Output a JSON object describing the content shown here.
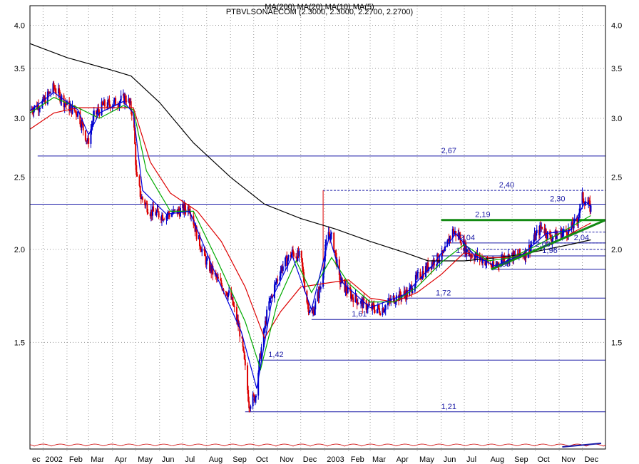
{
  "chart_data": {
    "type": "candlestick",
    "title": "PTBVLSONAECOM (2.3000, 2.3000, 2.2700, 2.2700)",
    "title_overlay": "MA(200) MA(20) MA(10) MA(5)",
    "yaxis": {
      "scale": "log",
      "range": [
        1.1,
        4.25
      ],
      "ticks": [
        1.5,
        2.0,
        2.5,
        3.0,
        3.5,
        4.0
      ],
      "tick_labels": [
        "1.5",
        "2.0",
        "2.5",
        "3.0",
        "3.5",
        "4.0"
      ]
    },
    "xaxis": {
      "range": [
        "2001-12-15",
        "2003-12-31"
      ],
      "tick_labels": [
        {
          "date": "2001-12-15",
          "label": "ec"
        },
        {
          "date": "2002-01-01",
          "label": "2002"
        },
        {
          "date": "2002-02-01",
          "label": "Feb"
        },
        {
          "date": "2002-03-01",
          "label": "Mar"
        },
        {
          "date": "2002-04-01",
          "label": "Apr"
        },
        {
          "date": "2002-05-01",
          "label": "May"
        },
        {
          "date": "2002-06-01",
          "label": "Jun"
        },
        {
          "date": "2002-07-01",
          "label": "Jul"
        },
        {
          "date": "2002-08-01",
          "label": "Aug"
        },
        {
          "date": "2002-09-01",
          "label": "Sep"
        },
        {
          "date": "2002-10-01",
          "label": "Oct"
        },
        {
          "date": "2002-11-01",
          "label": "Nov"
        },
        {
          "date": "2002-12-01",
          "label": "Dec"
        },
        {
          "date": "2003-01-01",
          "label": "2003"
        },
        {
          "date": "2003-02-01",
          "label": "Feb"
        },
        {
          "date": "2003-03-01",
          "label": "Mar"
        },
        {
          "date": "2003-04-01",
          "label": "Apr"
        },
        {
          "date": "2003-05-01",
          "label": "May"
        },
        {
          "date": "2003-06-01",
          "label": "Jun"
        },
        {
          "date": "2003-07-01",
          "label": "Jul"
        },
        {
          "date": "2003-08-01",
          "label": "Aug"
        },
        {
          "date": "2003-09-01",
          "label": "Sep"
        },
        {
          "date": "2003-10-01",
          "label": "Oct"
        },
        {
          "date": "2003-11-01",
          "label": "Nov"
        },
        {
          "date": "2003-12-01",
          "label": "Dec"
        }
      ]
    },
    "price_path": [
      [
        "2001-12-15",
        3.08
      ],
      [
        "2002-01-01",
        3.15
      ],
      [
        "2002-01-15",
        3.3
      ],
      [
        "2002-02-01",
        3.12
      ],
      [
        "2002-02-15",
        3.05
      ],
      [
        "2002-02-28",
        2.78
      ],
      [
        "2002-03-08",
        3.02
      ],
      [
        "2002-03-20",
        3.12
      ],
      [
        "2002-04-05",
        3.15
      ],
      [
        "2002-04-20",
        3.2
      ],
      [
        "2002-04-28",
        3.02
      ],
      [
        "2002-05-02",
        2.5
      ],
      [
        "2002-05-08",
        2.35
      ],
      [
        "2002-05-20",
        2.25
      ],
      [
        "2002-06-05",
        2.22
      ],
      [
        "2002-06-20",
        2.24
      ],
      [
        "2002-07-10",
        2.28
      ],
      [
        "2002-07-20",
        2.08
      ],
      [
        "2002-08-01",
        1.92
      ],
      [
        "2002-08-15",
        1.82
      ],
      [
        "2002-09-01",
        1.73
      ],
      [
        "2002-09-15",
        1.52
      ],
      [
        "2002-09-25",
        1.24
      ],
      [
        "2002-10-03",
        1.27
      ],
      [
        "2002-10-10",
        1.45
      ],
      [
        "2002-10-20",
        1.68
      ],
      [
        "2002-11-05",
        1.88
      ],
      [
        "2002-11-20",
        1.98
      ],
      [
        "2002-12-01",
        1.95
      ],
      [
        "2002-12-08",
        1.72
      ],
      [
        "2002-12-15",
        1.62
      ],
      [
        "2002-12-28",
        1.8
      ],
      [
        "2003-01-05",
        2.12
      ],
      [
        "2003-01-12",
        2.05
      ],
      [
        "2003-01-20",
        1.82
      ],
      [
        "2003-02-01",
        1.75
      ],
      [
        "2003-02-15",
        1.7
      ],
      [
        "2003-03-01",
        1.67
      ],
      [
        "2003-03-15",
        1.66
      ],
      [
        "2003-04-01",
        1.72
      ],
      [
        "2003-04-20",
        1.75
      ],
      [
        "2003-05-01",
        1.83
      ],
      [
        "2003-05-20",
        1.92
      ],
      [
        "2003-06-05",
        1.97
      ],
      [
        "2003-06-15",
        2.12
      ],
      [
        "2003-06-25",
        2.08
      ],
      [
        "2003-07-05",
        1.98
      ],
      [
        "2003-07-20",
        1.95
      ],
      [
        "2003-08-01",
        1.92
      ],
      [
        "2003-08-08",
        1.89
      ],
      [
        "2003-08-20",
        1.95
      ],
      [
        "2003-09-05",
        1.96
      ],
      [
        "2003-09-20",
        1.98
      ],
      [
        "2003-10-01",
        2.08
      ],
      [
        "2003-10-10",
        2.15
      ],
      [
        "2003-10-20",
        2.07
      ],
      [
        "2003-11-01",
        2.1
      ],
      [
        "2003-11-15",
        2.12
      ],
      [
        "2003-11-25",
        2.2
      ],
      [
        "2003-12-01",
        2.35
      ],
      [
        "2003-12-08",
        2.3
      ],
      [
        "2003-12-12",
        2.27
      ]
    ],
    "series": [
      {
        "name": "MA(200)",
        "color": "#000000",
        "points": [
          [
            "2001-12-15",
            3.78
          ],
          [
            "2002-02-01",
            3.62
          ],
          [
            "2002-04-01",
            3.48
          ],
          [
            "2002-04-25",
            3.42
          ],
          [
            "2002-06-01",
            3.15
          ],
          [
            "2002-07-15",
            2.78
          ],
          [
            "2002-09-01",
            2.5
          ],
          [
            "2002-10-15",
            2.3
          ],
          [
            "2002-12-01",
            2.2
          ],
          [
            "2003-01-15",
            2.13
          ],
          [
            "2003-03-01",
            2.05
          ],
          [
            "2003-04-15",
            1.98
          ],
          [
            "2003-05-15",
            1.93
          ],
          [
            "2003-07-01",
            1.93
          ],
          [
            "2003-08-15",
            1.95
          ],
          [
            "2003-09-15",
            1.97
          ],
          [
            "2003-10-15",
            2.0
          ],
          [
            "2003-11-15",
            2.03
          ],
          [
            "2003-12-12",
            2.06
          ]
        ]
      },
      {
        "name": "MA(20)",
        "color": "#dd0000",
        "points": [
          [
            "2001-12-15",
            2.9
          ],
          [
            "2002-01-15",
            3.05
          ],
          [
            "2002-02-15",
            3.1
          ],
          [
            "2002-04-01",
            3.1
          ],
          [
            "2002-04-28",
            3.1
          ],
          [
            "2002-05-20",
            2.62
          ],
          [
            "2002-06-15",
            2.38
          ],
          [
            "2002-07-20",
            2.25
          ],
          [
            "2002-08-20",
            2.05
          ],
          [
            "2002-09-20",
            1.78
          ],
          [
            "2002-10-15",
            1.52
          ],
          [
            "2002-11-05",
            1.65
          ],
          [
            "2002-12-01",
            1.78
          ],
          [
            "2003-01-01",
            1.8
          ],
          [
            "2003-02-01",
            1.82
          ],
          [
            "2003-03-01",
            1.72
          ],
          [
            "2003-04-01",
            1.7
          ],
          [
            "2003-05-01",
            1.75
          ],
          [
            "2003-06-01",
            1.85
          ],
          [
            "2003-07-01",
            1.98
          ],
          [
            "2003-08-01",
            1.95
          ],
          [
            "2003-09-01",
            1.95
          ],
          [
            "2003-10-01",
            1.99
          ],
          [
            "2003-11-01",
            2.06
          ],
          [
            "2003-12-12",
            2.17
          ]
        ]
      },
      {
        "name": "MA(10)",
        "color": "#00aa00",
        "points": [
          [
            "2001-12-15",
            3.05
          ],
          [
            "2002-01-15",
            3.2
          ],
          [
            "2002-02-15",
            3.1
          ],
          [
            "2002-03-15",
            3.0
          ],
          [
            "2002-04-15",
            3.12
          ],
          [
            "2002-04-28",
            3.08
          ],
          [
            "2002-05-15",
            2.55
          ],
          [
            "2002-06-15",
            2.25
          ],
          [
            "2002-07-15",
            2.25
          ],
          [
            "2002-08-15",
            1.93
          ],
          [
            "2002-09-20",
            1.6
          ],
          [
            "2002-10-10",
            1.38
          ],
          [
            "2002-11-01",
            1.7
          ],
          [
            "2002-11-25",
            1.93
          ],
          [
            "2002-12-15",
            1.75
          ],
          [
            "2003-01-10",
            1.95
          ],
          [
            "2003-02-01",
            1.8
          ],
          [
            "2003-03-01",
            1.7
          ],
          [
            "2003-04-01",
            1.7
          ],
          [
            "2003-05-01",
            1.78
          ],
          [
            "2003-06-01",
            1.92
          ],
          [
            "2003-07-01",
            2.03
          ],
          [
            "2003-08-01",
            1.93
          ],
          [
            "2003-09-01",
            1.95
          ],
          [
            "2003-10-01",
            2.02
          ],
          [
            "2003-11-01",
            2.1
          ],
          [
            "2003-12-12",
            2.22
          ]
        ]
      },
      {
        "name": "MA(5)",
        "color": "#0000dd",
        "points": [
          [
            "2001-12-15",
            3.07
          ],
          [
            "2002-01-15",
            3.25
          ],
          [
            "2002-02-15",
            3.08
          ],
          [
            "2002-03-01",
            2.85
          ],
          [
            "2002-03-15",
            3.05
          ],
          [
            "2002-04-15",
            3.16
          ],
          [
            "2002-04-28",
            3.05
          ],
          [
            "2002-05-10",
            2.4
          ],
          [
            "2002-06-10",
            2.23
          ],
          [
            "2002-07-10",
            2.25
          ],
          [
            "2002-08-10",
            1.88
          ],
          [
            "2002-09-15",
            1.55
          ],
          [
            "2002-10-05",
            1.3
          ],
          [
            "2002-10-25",
            1.72
          ],
          [
            "2002-11-20",
            1.96
          ],
          [
            "2002-12-15",
            1.66
          ],
          [
            "2003-01-07",
            2.08
          ],
          [
            "2003-01-25",
            1.8
          ],
          [
            "2003-03-01",
            1.67
          ],
          [
            "2003-04-15",
            1.74
          ],
          [
            "2003-05-20",
            1.9
          ],
          [
            "2003-06-20",
            2.1
          ],
          [
            "2003-07-15",
            1.96
          ],
          [
            "2003-08-10",
            1.9
          ],
          [
            "2003-09-15",
            1.97
          ],
          [
            "2003-10-15",
            2.1
          ],
          [
            "2003-11-15",
            2.12
          ],
          [
            "2003-12-05",
            2.32
          ],
          [
            "2003-12-12",
            2.28
          ]
        ]
      }
    ],
    "levels": [
      {
        "value": 2.67,
        "label": "2,67",
        "style": "solid",
        "start": "2001-12-25",
        "label_at": "2003-06-01"
      },
      {
        "value": 2.3,
        "label": "2,30",
        "style": "solid",
        "start": "2001-12-15",
        "label_at": "2003-10-20"
      },
      {
        "value": 2.4,
        "label": "2,40",
        "style": "dashed",
        "start": "2002-12-30",
        "label_at": "2003-08-15"
      },
      {
        "value": 2.19,
        "label": "2,19",
        "style": "thick-green",
        "start": "2003-06-01",
        "label_at": "2003-07-15"
      },
      {
        "value": 2.11,
        "label": "",
        "style": "dashed",
        "start": "2003-10-01",
        "label_at": ""
      },
      {
        "value": 2.04,
        "label": "2,04",
        "style": "solid",
        "start": "2003-06-05",
        "label_at": "2003-06-25"
      },
      {
        "value": 2.0,
        "label": "2,00",
        "style": "dashed",
        "start": "2003-07-25",
        "label_at": "2003-10-01"
      },
      {
        "value": 2.04,
        "label": "2,04",
        "style": "dashed",
        "start": "2003-10-15",
        "label_at": "2003-11-20"
      },
      {
        "value": 1.96,
        "label": "1,96",
        "style": "solid",
        "start": "2003-05-20",
        "label_at": "2003-06-20"
      },
      {
        "value": 1.96,
        "label": "1,96",
        "style": "solid",
        "start": "2003-09-20",
        "label_at": "2003-10-10"
      },
      {
        "value": 1.88,
        "label": "1,88",
        "style": "solid",
        "start": "2003-08-05",
        "label_at": "2003-08-10"
      },
      {
        "value": 1.72,
        "label": "1,72",
        "style": "solid",
        "start": "2003-04-15",
        "label_at": "2003-05-25"
      },
      {
        "value": 1.61,
        "label": "1,61",
        "style": "solid",
        "start": "2002-12-15",
        "label_at": "2003-02-05"
      },
      {
        "value": 1.42,
        "label": "1,42",
        "style": "solid",
        "start": "2002-10-10",
        "label_at": "2002-10-20"
      },
      {
        "value": 1.21,
        "label": "1,21",
        "style": "solid",
        "start": "2002-09-20",
        "label_at": "2003-06-01"
      }
    ],
    "trendline": {
      "color": "#138a13",
      "from": [
        "2003-08-05",
        1.88
      ],
      "to": [
        "2003-12-31",
        2.19
      ]
    },
    "grid": true,
    "legend": "none",
    "colors": {
      "bull": "#0000cc",
      "bear": "#dd0000",
      "level": "#1a1aa6",
      "trend": "#138a13"
    }
  }
}
